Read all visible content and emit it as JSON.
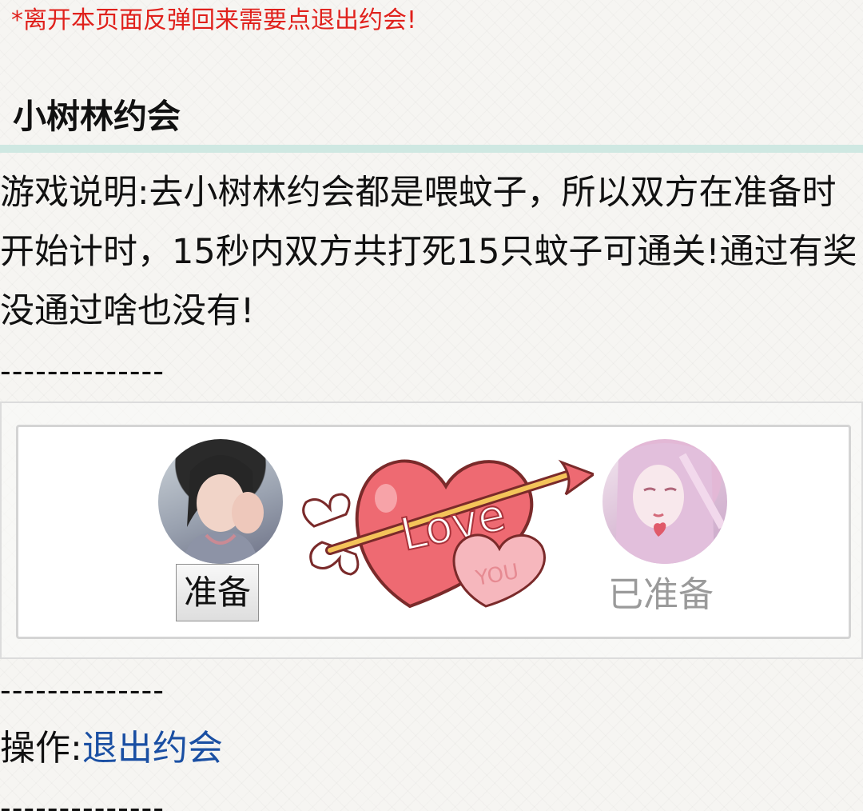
{
  "notice": "*离开本页面反弹回来需要点退出约会!",
  "title": "小树林约会",
  "description": "游戏说明:去小树林约会都是喂蚊子，所以双方在准备时开始计时，15秒内双方共打死15只蚊子可通关!通过有奖没通过啥也没有!",
  "divider": "--------------",
  "game": {
    "left_player": {
      "button_label": "准备"
    },
    "right_player": {
      "status_label": "已准备"
    },
    "heart_text_love": "Love",
    "heart_text_you": "YOU"
  },
  "operation": {
    "label": "操作:",
    "exit_link": "退出约会"
  },
  "colors": {
    "notice": "#e0211c",
    "link": "#1a4fa3",
    "divider": "#cfe8e2"
  }
}
